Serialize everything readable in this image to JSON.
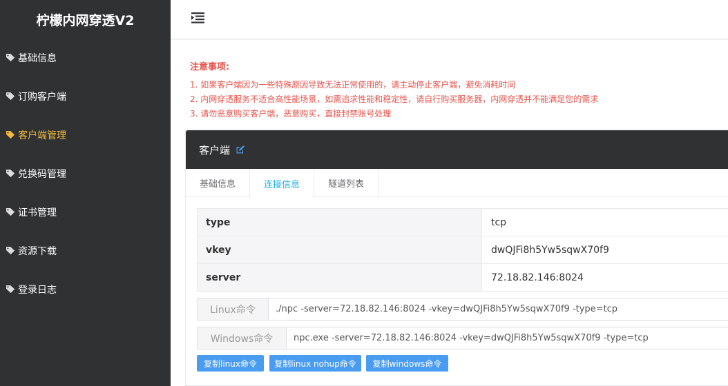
{
  "app": {
    "title": "柠檬内网穿透V2"
  },
  "sidebar": {
    "items": [
      {
        "label": "基础信息",
        "active": false
      },
      {
        "label": "订购客户端",
        "active": false
      },
      {
        "label": "客户端管理",
        "active": true
      },
      {
        "label": "兑换码管理",
        "active": false
      },
      {
        "label": "证书管理",
        "active": false
      },
      {
        "label": "资源下载",
        "active": false
      },
      {
        "label": "登录日志",
        "active": false
      }
    ]
  },
  "notice": {
    "title": "注意事项:",
    "lines": [
      "1. 如果客户端因为一些特殊原因导致无法正常使用的，请主动停止客户端，避免消耗时间",
      "2. 内网穿透服务不适合高性能场景，如需追求性能和稳定性，请自行购买服务器，内网穿透并不能满足您的需求",
      "3. 请勿恶意购买客户端，恶意购买，直接封禁账号处理"
    ]
  },
  "panel": {
    "title": "客户端",
    "tabs": [
      {
        "label": "基础信息",
        "active": false
      },
      {
        "label": "连接信息",
        "active": true
      },
      {
        "label": "隧道列表",
        "active": false
      }
    ],
    "info": [
      {
        "key": "type",
        "value": "tcp"
      },
      {
        "key": "vkey",
        "value": "dwQJFi8h5Yw5sqwX70f9"
      },
      {
        "key": "server",
        "value": "72.18.82.146:8024"
      }
    ],
    "commands": [
      {
        "label": "Linux命令",
        "value": "./npc -server=72.18.82.146:8024 -vkey=dwQJFi8h5Yw5sqwX70f9 -type=tcp"
      },
      {
        "label": "Windows命令",
        "value": "npc.exe -server=72.18.82.146:8024 -vkey=dwQJFi8h5Yw5sqwX70f9 -type=tcp"
      }
    ],
    "buttons": [
      {
        "label": "复制linux命令"
      },
      {
        "label": "复制linux nohup命令"
      },
      {
        "label": "复制windows命令"
      }
    ]
  },
  "colors": {
    "sidebar_bg": "#2f3133",
    "active_nav": "#f1b83b",
    "notice_red": "#e5534b",
    "tab_active": "#1ab0e8",
    "button_blue": "#4a9cf0"
  },
  "icons": {
    "nav": "tag-icon",
    "toggle": "menu-toggle-icon",
    "edit": "edit-icon"
  }
}
